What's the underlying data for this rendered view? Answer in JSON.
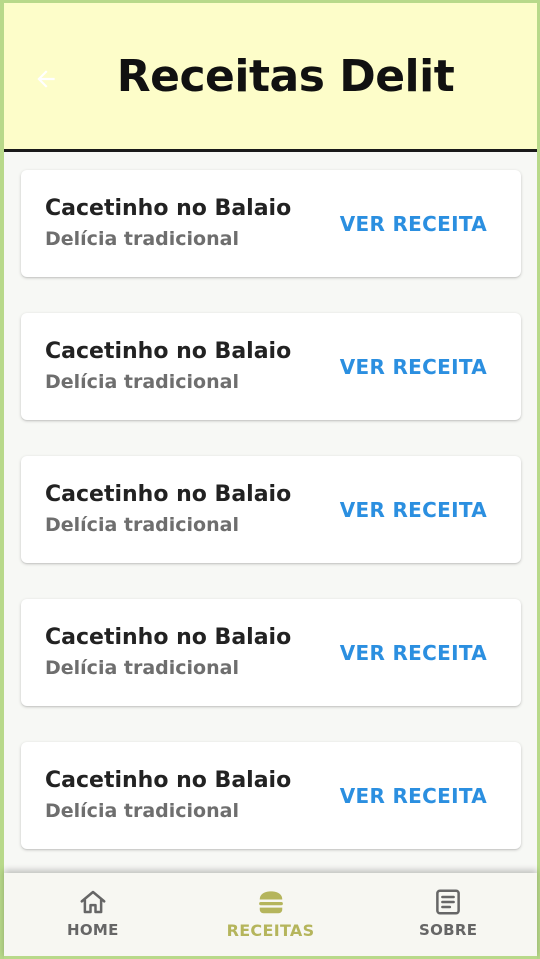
{
  "header": {
    "title": "Receitas Delit",
    "back_icon": "arrow-left-icon"
  },
  "recipes": [
    {
      "title": "Cacetinho no Balaio",
      "subtitle": "Delícia tradicional",
      "action": "VER RECEITA"
    },
    {
      "title": "Cacetinho no Balaio",
      "subtitle": "Delícia tradicional",
      "action": "VER RECEITA"
    },
    {
      "title": "Cacetinho no Balaio",
      "subtitle": "Delícia tradicional",
      "action": "VER RECEITA"
    },
    {
      "title": "Cacetinho no Balaio",
      "subtitle": "Delícia tradicional",
      "action": "VER RECEITA"
    },
    {
      "title": "Cacetinho no Balaio",
      "subtitle": "Delícia tradicional",
      "action": "VER RECEITA"
    }
  ],
  "bottom_nav": {
    "items": [
      {
        "label": "HOME",
        "icon": "home-icon",
        "active": false
      },
      {
        "label": "RECEITAS",
        "icon": "burger-icon",
        "active": true
      },
      {
        "label": "SOBRE",
        "icon": "article-icon",
        "active": false
      }
    ]
  },
  "colors": {
    "header_bg": "#fdfdc9",
    "accent": "#2b8fe0",
    "active_nav": "#b5b55c",
    "frame": "#b8d98a"
  }
}
